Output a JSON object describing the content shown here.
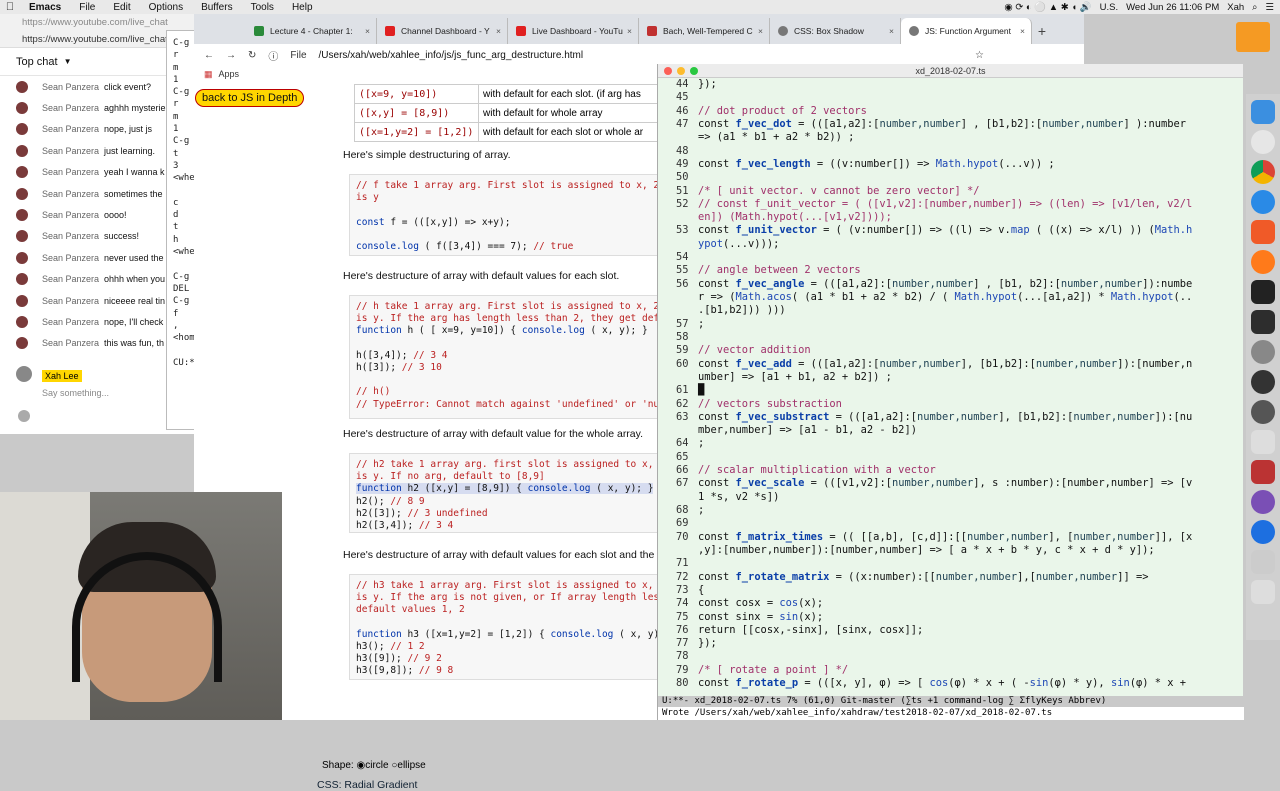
{
  "menubar": {
    "app": "Emacs",
    "items": [
      "File",
      "Edit",
      "Options",
      "Buffers",
      "Tools",
      "Help"
    ],
    "status": [
      "U.S.",
      "Wed Jun 26  11:06 PM",
      "Xah"
    ]
  },
  "chat": {
    "urls": [
      "https://www.youtube.com/live_chat",
      "https://www.youtube.com/live_chat"
    ],
    "header": "Top chat",
    "messages": [
      {
        "name": "Sean Panzera",
        "text": "click event?"
      },
      {
        "name": "Sean Panzera",
        "text": "aghhh mysterie"
      },
      {
        "name": "Sean Panzera",
        "text": "nope, just js"
      },
      {
        "name": "Sean Panzera",
        "text": "just learning."
      },
      {
        "name": "Sean Panzera",
        "text": "yeah I wanna k"
      },
      {
        "name": "Sean Panzera",
        "text": "sometimes the"
      },
      {
        "name": "Sean Panzera",
        "text": "oooo!"
      },
      {
        "name": "Sean Panzera",
        "text": "success!"
      },
      {
        "name": "Sean Panzera",
        "text": "never used the"
      },
      {
        "name": "Sean Panzera",
        "text": "ohhh when you"
      },
      {
        "name": "Sean Panzera",
        "text": "niceeee real tin"
      },
      {
        "name": "Sean Panzera",
        "text": "nope, I'll check"
      },
      {
        "name": "Sean Panzera",
        "text": "this was fun, th"
      }
    ],
    "me_name": "Xah Lee",
    "placeholder": "Say something..."
  },
  "emacs_small": "C-g\nr\nm\n1\nC-g\nr\nm\n1\nC-g\nt\n3\n<whe\n\nc\nd\nt\nh\n<whe\n\nC-g\nDEL\nC-g\nf\n,\n<hom\n\nCU:**",
  "chrome": {
    "tabs": [
      {
        "label": "Lecture 4 - Chapter 1:",
        "color": "#2a8a3a"
      },
      {
        "label": "Channel Dashboard - Y",
        "color": "#e02020"
      },
      {
        "label": "Live Dashboard - YouTu",
        "color": "#e02020"
      },
      {
        "label": "Bach, Well-Tempered C",
        "color": "#c03030"
      },
      {
        "label": "CSS: Box Shadow",
        "color": "#555"
      },
      {
        "label": "JS: Function Argument",
        "color": "#555"
      }
    ],
    "url_label": "File",
    "url": "/Users/xah/web/xahlee_info/js/js_func_arg_destructure.html",
    "bookmark": "Apps",
    "back_link": "back to JS in Depth",
    "table": [
      [
        "([x=9, y=10])",
        "with default for each slot. (if arg has"
      ],
      [
        "([x,y] = [8,9])",
        "with default for whole array"
      ],
      [
        "([x=1,y=2] = [1,2])",
        "with default for each slot or whole ar"
      ]
    ],
    "p1": "Here's simple destructuring of array.",
    "p2": "Here's destructure of array with default values for each slot.",
    "p3": "Here's destructure of array with default value for the whole array.",
    "p4": "Here's destructure of array with default values for each slot and the",
    "shape_label": "Shape:",
    "shape_opts": [
      "circle",
      "ellipse"
    ],
    "radial": "CSS: Radial Gradient"
  },
  "emacs": {
    "filename": "xd_2018-02-07.ts",
    "modeline": "U:**- xd_2018-02-07.ts    7% (61,0)    Git-master  (∑ts +1 command-log ∑ ΣflyKeys Abbrev)",
    "echo": "Wrote /Users/xah/web/xahlee_info/xahdraw/test2018-02-07/xd_2018-02-07.ts"
  }
}
